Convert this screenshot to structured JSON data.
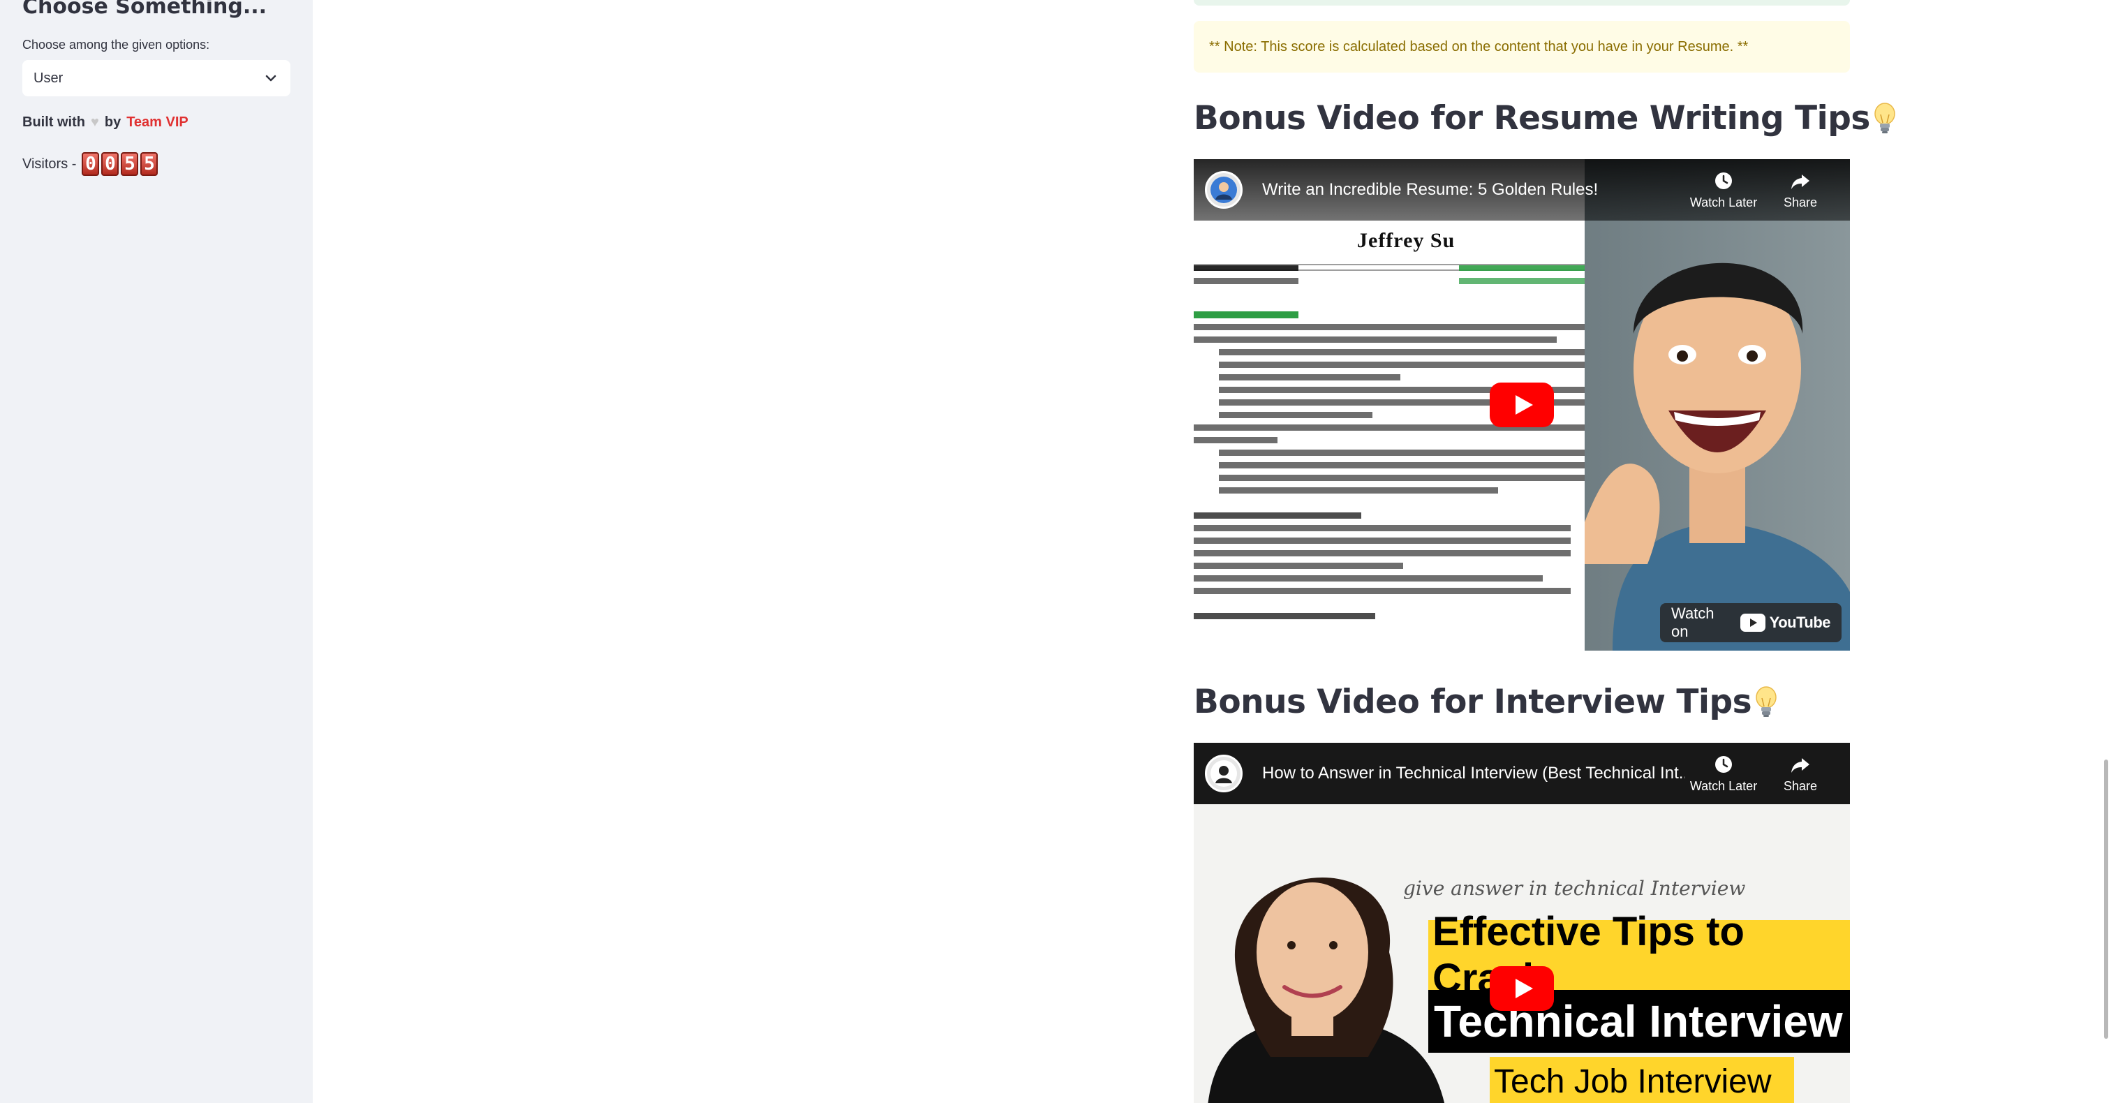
{
  "sidebar": {
    "title": "Choose Something...",
    "select_label": "Choose among the given options:",
    "select_value": "User",
    "built_prefix": "Built with",
    "built_by": "by",
    "team_name": "Team VIP",
    "visitors_label": "Visitors -",
    "visitor_digits": [
      "0",
      "0",
      "5",
      "5"
    ]
  },
  "main": {
    "note": "** Note: This score is calculated based on the content that you have in your Resume. **",
    "resume_heading": "Bonus Video for Resume Writing Tips",
    "interview_heading": "Bonus Video for Interview Tips",
    "video1": {
      "title": "Write an Incredible Resume: 5 Golden Rules!",
      "watch_later": "Watch Later",
      "share": "Share",
      "watch_on": "Watch on",
      "youtube": "YouTube",
      "thumb_name": "Jeffrey Su"
    },
    "video2": {
      "title": "How to Answer in Technical Interview (Best Technical Int...",
      "watch_later": "Watch Later",
      "share": "Share",
      "thumb_line1": "Effective Tips to Crack",
      "thumb_line2": "Technical Interview",
      "thumb_line3": "Tech Job Interview",
      "thumb_handwriting": "give answer in technical Interview"
    }
  },
  "colors": {
    "sidebar_bg": "#f0f2f6",
    "note_bg": "#fffce6",
    "note_text": "#8a6d00",
    "team_red": "#e03131",
    "yt_red": "#ff0000"
  }
}
